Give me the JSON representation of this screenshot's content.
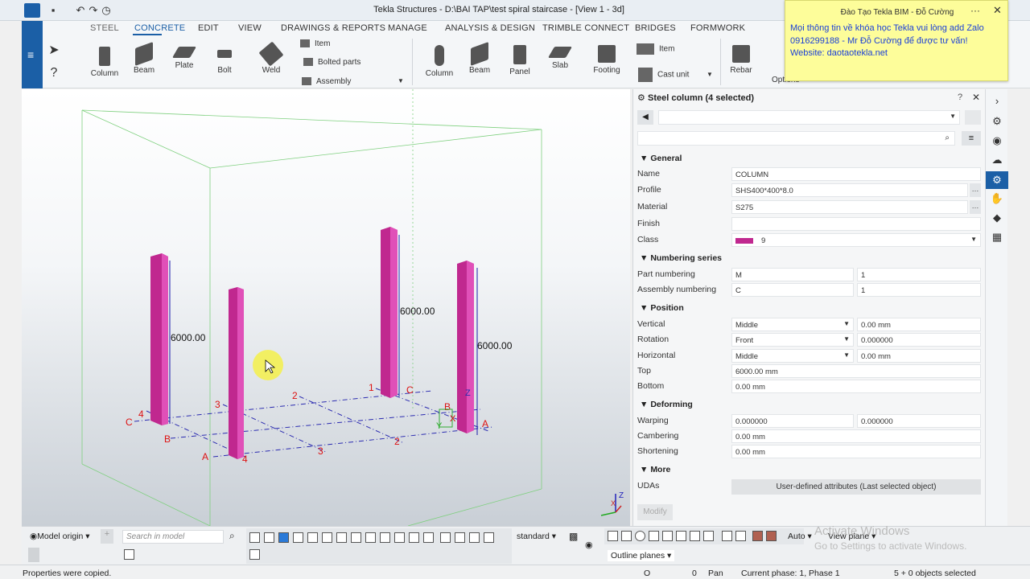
{
  "window": {
    "title": "Tekla Structures - D:\\BAI TAP\\test spiral staircase  - [View 1 - 3d]"
  },
  "menu": [
    "STEEL",
    "CONCRETE",
    "EDIT",
    "VIEW",
    "DRAWINGS & REPORTS",
    "MANAGE",
    "ANALYSIS & DESIGN",
    "TRIMBLE CONNECT",
    "BRIDGES",
    "FORMWORK"
  ],
  "ribbon": {
    "steel": {
      "column": "Column",
      "beam": "Beam",
      "plate": "Plate",
      "bolt": "Bolt",
      "weld": "Weld",
      "item": "Item",
      "bolted_parts": "Bolted parts",
      "assembly": "Assembly"
    },
    "concrete": {
      "column": "Column",
      "beam": "Beam",
      "panel": "Panel",
      "slab": "Slab",
      "footing": "Footing",
      "item": "Item",
      "cast_unit": "Cast unit",
      "rebar": "Rebar",
      "options": "Options"
    }
  },
  "toast": {
    "header": "Đào Tạo Tekla BIM - Đỗ Cường",
    "line1": "Mọi thông tin về khóa học Tekla vui lòng add Zalo",
    "line2": "0916299188 - Mr Đỗ Cường để được tư vấn!",
    "line3": "Website: daotaotekla.net"
  },
  "viewport": {
    "dims": [
      "6000.00",
      "6000.00",
      "6000.00"
    ],
    "grid_labels": {
      "c_left": "C",
      "four_left": "4",
      "b": "B",
      "a": "A",
      "three_a": "3",
      "two_a": "2",
      "one": "1",
      "c_right": "C",
      "b_right": "B",
      "a_right": "A",
      "three_b": "3",
      "two_b": "2",
      "four_b": "4",
      "x": "X",
      "y": "Y",
      "z": "Z",
      "axis_z": "Z",
      "axis_x": "X"
    }
  },
  "panel": {
    "title": "Steel column (4 selected)",
    "sections": {
      "general": "General",
      "numbering": "Numbering series",
      "position": "Position",
      "deforming": "Deforming",
      "more": "More"
    },
    "name": {
      "label": "Name",
      "value": "COLUMN"
    },
    "profile": {
      "label": "Profile",
      "value": "SHS400*400*8.0"
    },
    "material": {
      "label": "Material",
      "value": "S275"
    },
    "finish": {
      "label": "Finish",
      "value": ""
    },
    "class": {
      "label": "Class",
      "value": "9",
      "color": "#c0288f"
    },
    "part_numbering": {
      "label": "Part numbering",
      "prefix": "M",
      "start": "1"
    },
    "assembly_numbering": {
      "label": "Assembly numbering",
      "prefix": "C",
      "start": "1"
    },
    "vertical": {
      "label": "Vertical",
      "option": "Middle",
      "value": "0.00 mm"
    },
    "rotation": {
      "label": "Rotation",
      "option": "Front",
      "value": "0.000000"
    },
    "horizontal": {
      "label": "Horizontal",
      "option": "Middle",
      "value": "0.00 mm"
    },
    "top": {
      "label": "Top",
      "value": "6000.00 mm"
    },
    "bottom": {
      "label": "Bottom",
      "value": "0.00 mm"
    },
    "warping": {
      "label": "Warping",
      "v1": "0.000000",
      "v2": "0.000000"
    },
    "cambering": {
      "label": "Cambering",
      "value": "0.00 mm"
    },
    "shortening": {
      "label": "Shortening",
      "value": "0.00 mm"
    },
    "udas": {
      "label": "UDAs",
      "button": "User-defined attributes (Last selected object)"
    },
    "modify": "Modify"
  },
  "bottom": {
    "model_origin": "Model origin",
    "search_placeholder": "Search in model",
    "standard": "standard",
    "auto": "Auto",
    "view_plane": "View plane",
    "outline_planes": "Outline planes",
    "activate1": "Activate Windows",
    "activate2": "Go to Settings to activate Windows."
  },
  "status": {
    "message": "Properties were copied.",
    "o": "O",
    "zero": "0",
    "pan": "Pan",
    "phase": "Current phase: 1, Phase 1",
    "selected": "5 + 0 objects selected"
  }
}
